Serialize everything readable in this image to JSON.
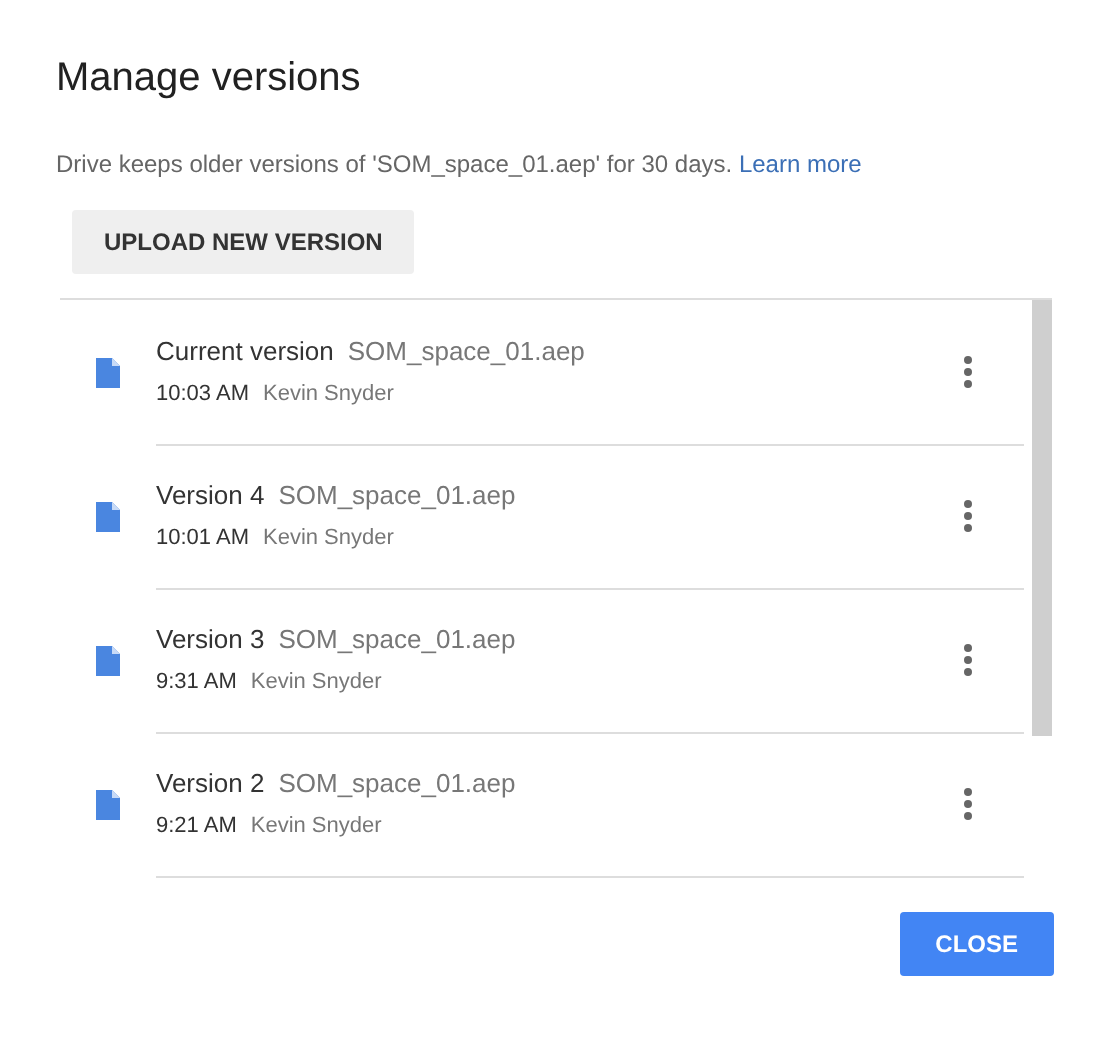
{
  "dialog": {
    "title": "Manage versions",
    "description": {
      "text": "Drive keeps older versions of 'SOM_space_01.aep' for 30 days.",
      "link": "Learn more"
    },
    "upload_button": "UPLOAD NEW VERSION",
    "versions": [
      {
        "label": "Current version",
        "file": "SOM_space_01.aep",
        "time": "10:03 AM",
        "author": "Kevin Snyder"
      },
      {
        "label": "Version 4",
        "file": "SOM_space_01.aep",
        "time": "10:01 AM",
        "author": "Kevin Snyder"
      },
      {
        "label": "Version 3",
        "file": "SOM_space_01.aep",
        "time": "9:31 AM",
        "author": "Kevin Snyder"
      },
      {
        "label": "Version 2",
        "file": "SOM_space_01.aep",
        "time": "9:21 AM",
        "author": "Kevin Snyder"
      }
    ],
    "close_button": "CLOSE"
  }
}
